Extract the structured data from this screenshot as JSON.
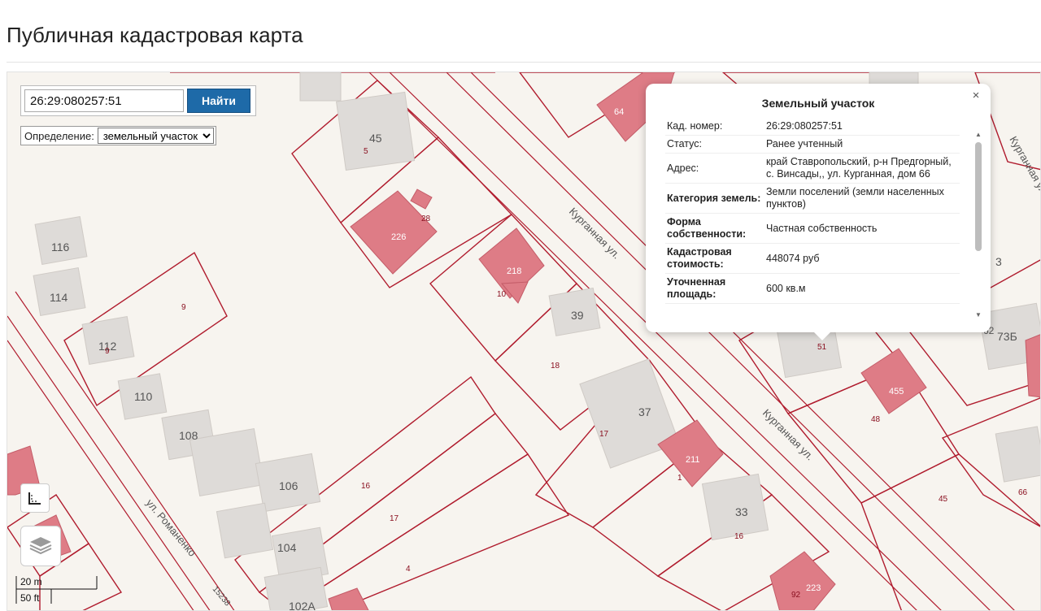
{
  "page": {
    "title": "Публичная кадастровая карта"
  },
  "search": {
    "value": "26:29:080257:51",
    "button_label": "Найти"
  },
  "definition": {
    "label": "Определение:",
    "selected": "земельный участок"
  },
  "popup": {
    "title": "Земельный участок",
    "close": "×",
    "rows": [
      {
        "key": "Кад. номер:",
        "value": "26:29:080257:51"
      },
      {
        "key": "Статус:",
        "value": "Ранее учтенный"
      },
      {
        "key": "Адрес:",
        "value": "край Ставропольский, р-н Предгорный, с. Винсады,, ул. Курганная, дом 66"
      },
      {
        "key": "Категория земель:",
        "value": "Земли поселений (земли населенных пунктов)"
      },
      {
        "key": "Форма собственности:",
        "value": "Частная собственность"
      },
      {
        "key": "Кадастровая стоимость:",
        "value": "448074 руб"
      },
      {
        "key": "Уточненная площадь:",
        "value": "600 кв.м"
      }
    ]
  },
  "map": {
    "street_labels": [
      "Курганная ул.",
      "Курганная ул.",
      "ул. Романенко",
      "Курганная ул."
    ],
    "building_labels": [
      "45",
      "5",
      "226",
      "28",
      "218",
      "10",
      "116",
      "114",
      "9",
      "112",
      "9",
      "110",
      "108",
      "106",
      "104",
      "102А",
      "39",
      "18",
      "37",
      "17",
      "211",
      "1",
      "33",
      "16",
      "223",
      "92",
      "16",
      "17",
      "4",
      "51",
      "455",
      "48",
      "45",
      "66",
      "73Б",
      "62",
      "64",
      "3",
      "15238"
    ],
    "scale": {
      "metric": "20 m",
      "imperial": "50 ft"
    },
    "colors": {
      "parcel_line": "#b01c2e",
      "building_red": "#de7c86",
      "building_grey": "#dedbd8",
      "background": "#f7f4ef"
    }
  }
}
